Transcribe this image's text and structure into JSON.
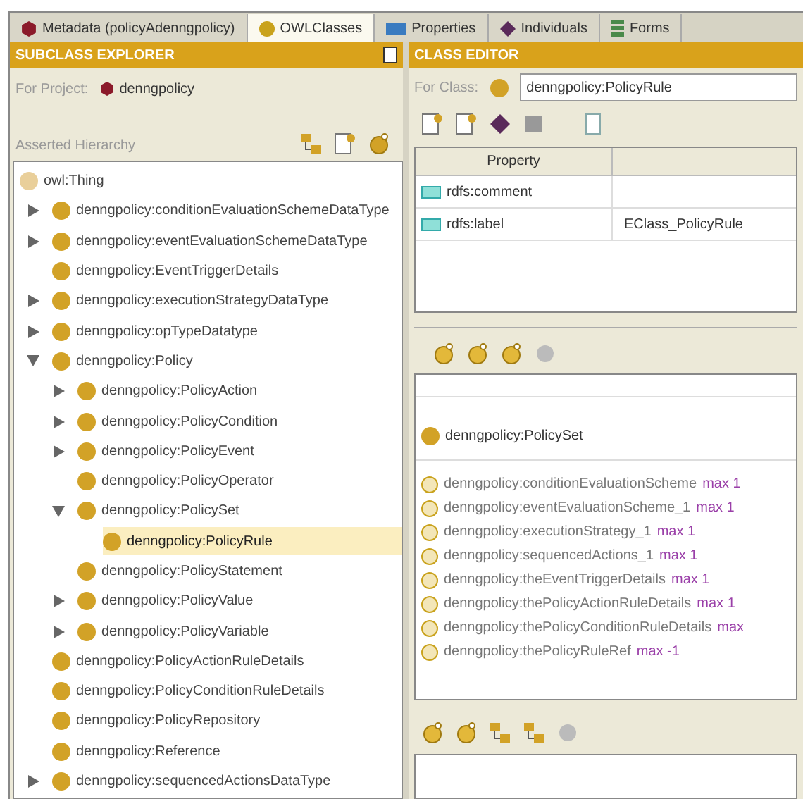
{
  "tabs": [
    {
      "label": "Metadata (policyAdenngpolicy)",
      "selected": false
    },
    {
      "label": "OWLClasses",
      "selected": true
    },
    {
      "label": "Properties",
      "selected": false
    },
    {
      "label": "Individuals",
      "selected": false
    },
    {
      "label": "Forms",
      "selected": false
    }
  ],
  "subclass_explorer": {
    "title": "SUBCLASS EXPLORER",
    "project_label": "For Project:",
    "project_name": "denngpolicy",
    "hierarchy_label": "Asserted Hierarchy",
    "tree": {
      "root": "owl:Thing",
      "items": [
        {
          "label": "denngpolicy:conditionEvaluationSchemeDataType",
          "expandable": true,
          "expanded": false,
          "selected": false
        },
        {
          "label": "denngpolicy:eventEvaluationSchemeDataType",
          "expandable": true,
          "expanded": false,
          "selected": false
        },
        {
          "label": "denngpolicy:EventTriggerDetails",
          "expandable": false,
          "selected": false
        },
        {
          "label": "denngpolicy:executionStrategyDataType",
          "expandable": true,
          "expanded": false,
          "selected": false
        },
        {
          "label": "denngpolicy:opTypeDatatype",
          "expandable": true,
          "expanded": false,
          "selected": false
        },
        {
          "label": "denngpolicy:Policy",
          "expandable": true,
          "expanded": true,
          "selected": false,
          "children": [
            {
              "label": "denngpolicy:PolicyAction",
              "expandable": true,
              "expanded": false,
              "selected": false
            },
            {
              "label": "denngpolicy:PolicyCondition",
              "expandable": true,
              "expanded": false,
              "selected": false
            },
            {
              "label": "denngpolicy:PolicyEvent",
              "expandable": true,
              "expanded": false,
              "selected": false
            },
            {
              "label": "denngpolicy:PolicyOperator",
              "expandable": false,
              "selected": false
            },
            {
              "label": "denngpolicy:PolicySet",
              "expandable": true,
              "expanded": true,
              "selected": false,
              "children": [
                {
                  "label": "denngpolicy:PolicyRule",
                  "expandable": false,
                  "selected": true
                }
              ]
            },
            {
              "label": "denngpolicy:PolicyStatement",
              "expandable": false,
              "selected": false
            },
            {
              "label": "denngpolicy:PolicyValue",
              "expandable": true,
              "expanded": false,
              "selected": false
            },
            {
              "label": "denngpolicy:PolicyVariable",
              "expandable": true,
              "expanded": false,
              "selected": false
            }
          ]
        },
        {
          "label": "denngpolicy:PolicyActionRuleDetails",
          "expandable": false,
          "selected": false
        },
        {
          "label": "denngpolicy:PolicyConditionRuleDetails",
          "expandable": false,
          "selected": false
        },
        {
          "label": "denngpolicy:PolicyRepository",
          "expandable": false,
          "selected": false
        },
        {
          "label": "denngpolicy:Reference",
          "expandable": false,
          "selected": false
        },
        {
          "label": "denngpolicy:sequencedActionsDataType",
          "expandable": true,
          "expanded": false,
          "selected": false
        }
      ]
    }
  },
  "class_editor": {
    "title": "CLASS EDITOR",
    "class_label": "For Class:",
    "class_name": "denngpolicy:PolicyRule",
    "table": {
      "columns": [
        "Property"
      ],
      "rows": [
        {
          "property": "rdfs:comment"
        },
        {
          "property": "rdfs:label",
          "value": "EClass_PolicyRule"
        }
      ]
    },
    "superclass": "denngpolicy:PolicySet",
    "restrictions": [
      {
        "property": "denngpolicy:conditionEvaluationScheme",
        "cardinality": "max 1"
      },
      {
        "property": "denngpolicy:eventEvaluationScheme_1",
        "cardinality": "max 1"
      },
      {
        "property": "denngpolicy:executionStrategy_1",
        "cardinality": "max 1"
      },
      {
        "property": "denngpolicy:sequencedActions_1",
        "cardinality": "max 1"
      },
      {
        "property": "denngpolicy:theEventTriggerDetails",
        "cardinality": "max 1"
      },
      {
        "property": "denngpolicy:thePolicyActionRuleDetails",
        "cardinality": "max 1"
      },
      {
        "property": "denngpolicy:thePolicyConditionRuleDetails",
        "cardinality": "max"
      },
      {
        "property": "denngpolicy:thePolicyRuleRef",
        "cardinality": "max -1"
      }
    ]
  }
}
